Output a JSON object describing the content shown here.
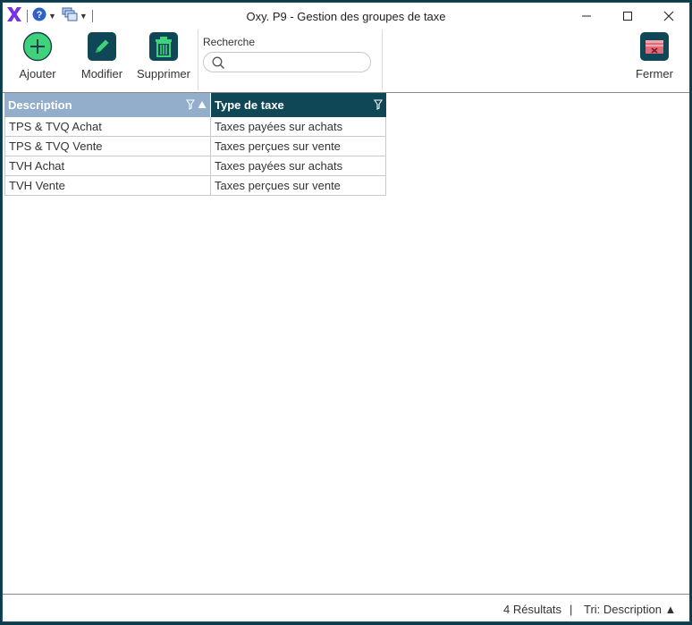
{
  "window": {
    "title": "Oxy. P9 - Gestion des groupes de taxe",
    "accent": "#0d3b4c"
  },
  "quick_access": {
    "logo_icon": "oxy-x-logo",
    "help_icon": "help-icon",
    "windows_icon": "windows-icon"
  },
  "toolbar": {
    "add_label": "Ajouter",
    "edit_label": "Modifier",
    "delete_label": "Supprimer",
    "close_label": "Fermer"
  },
  "search": {
    "label": "Recherche",
    "value": "",
    "placeholder": ""
  },
  "grid": {
    "columns": [
      "Description",
      "Type de taxe"
    ],
    "rows": [
      [
        "TPS & TVQ Achat",
        "Taxes payées sur achats"
      ],
      [
        "TPS & TVQ Vente",
        "Taxes perçues sur vente"
      ],
      [
        "TVH Achat",
        "Taxes payées sur achats"
      ],
      [
        "TVH Vente",
        "Taxes perçues sur vente"
      ]
    ]
  },
  "status": {
    "results": "4 Résultats",
    "separator": "|",
    "sort": "Tri: Description ▲"
  }
}
